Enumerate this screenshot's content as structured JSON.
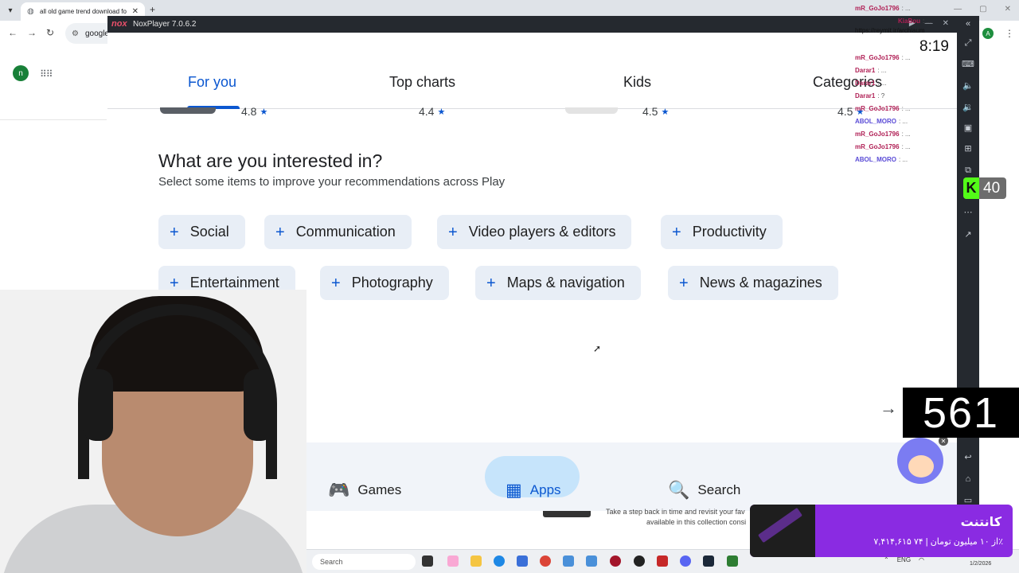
{
  "browser": {
    "tab_title": "all old game trend download fo",
    "omnibox_text": "google",
    "profile_initial": "A"
  },
  "google_page": {
    "avatar_initial": "n"
  },
  "nox": {
    "logo": "nox",
    "title": "NoxPlayer 7.0.6.2"
  },
  "play": {
    "tabs": [
      "For you",
      "Top charts",
      "Kids",
      "Categories"
    ],
    "ratings": [
      "4.8",
      "4.4",
      "4.5",
      "4.5"
    ],
    "interest_title": "What are you interested in?",
    "interest_subtitle": "Select some items to improve your recommendations across Play",
    "chips_row1": [
      "Social",
      "Communication",
      "Video players & editors",
      "Productivity"
    ],
    "chips_row2": [
      "Entertainment",
      "Photography",
      "Maps & navigation",
      "News & magazines"
    ],
    "partial_heading": "s",
    "bottom_nav": [
      "Games",
      "Apps",
      "Search"
    ]
  },
  "below_page": {
    "line1": "Take a step back in time and revisit your fav",
    "line2": "available in this collection consi"
  },
  "taskbar": {
    "search_placeholder": "Search",
    "lang": "ENG",
    "date": "1/2/2026"
  },
  "stream": {
    "chat": [
      {
        "user": "mR_GoJo1796",
        "msg": ": ..."
      },
      {
        "user": "KiaBou",
        "msg": ": ..."
      },
      {
        "user": "mR_GoJo1796",
        "msg": ": ..."
      },
      {
        "user": "Darar1",
        "msg": ": ..."
      },
      {
        "user": "Darar1",
        "msg": ": ..."
      },
      {
        "user": "Darar1",
        "msg": ": ?"
      },
      {
        "user": "mR_GoJo1796",
        "msg": ": ..."
      },
      {
        "user": "ABOL_MORO",
        "msg": ": ..."
      },
      {
        "user": "mR_GoJo1796",
        "msg": ": ..."
      },
      {
        "user": "mR_GoJo1796",
        "msg": ": ..."
      },
      {
        "user": "ABOL_MORO",
        "msg": ": ..."
      }
    ],
    "link": "https://reymit.ir/archiaum",
    "clock": "8:19",
    "kick_viewers": "40",
    "counter": "561",
    "donation_title": "کانتنت",
    "donation_amount": "۷,۴۱۴,۶۱۵ از ۱۰ میلیون تومان | ۷۴٪"
  }
}
